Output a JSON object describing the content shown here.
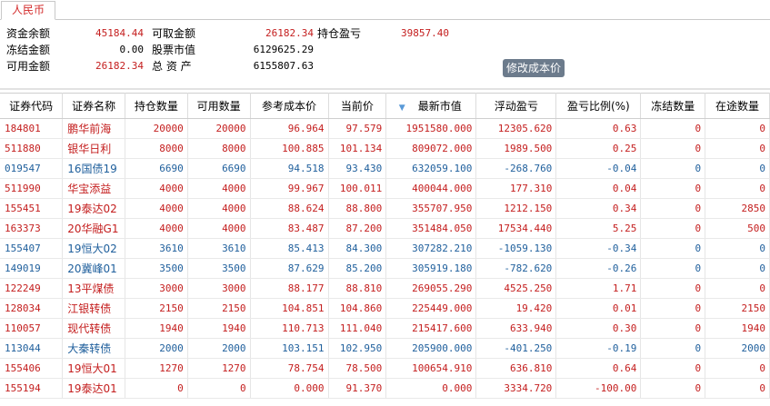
{
  "tab": {
    "label": "人民币"
  },
  "summary": {
    "row1": [
      {
        "label": "资金余额",
        "value": "45184.44"
      },
      {
        "label": "可取金额",
        "value": "26182.34"
      },
      {
        "label": "持仓盈亏",
        "value": "39857.40"
      }
    ],
    "row2": [
      {
        "label": "冻结金额",
        "value": "0.00"
      },
      {
        "label": "股票市值",
        "value": "6129625.29"
      }
    ],
    "row3": [
      {
        "label": "可用金额",
        "value": "26182.34"
      },
      {
        "label": "总 资 产",
        "value": "6155807.63"
      }
    ],
    "modify_cost_button": "修改成本价"
  },
  "table": {
    "headers": [
      "证券代码",
      "证券名称",
      "持仓数量",
      "可用数量",
      "参考成本价",
      "当前价",
      "最新市值",
      "浮动盈亏",
      "盈亏比例(%)",
      "冻结数量",
      "在途数量"
    ],
    "sorted_column": "最新市值",
    "rows": [
      {
        "color": "red",
        "cells": [
          "184801",
          "鹏华前海",
          "20000",
          "20000",
          "96.964",
          "97.579",
          "1951580.000",
          "12305.620",
          "0.63",
          "0",
          "0"
        ]
      },
      {
        "color": "red",
        "cells": [
          "511880",
          "银华日利",
          "8000",
          "8000",
          "100.885",
          "101.134",
          "809072.000",
          "1989.500",
          "0.25",
          "0",
          "0"
        ]
      },
      {
        "color": "blue",
        "cells": [
          "019547",
          "16国债19",
          "6690",
          "6690",
          "94.518",
          "93.430",
          "632059.100",
          "-268.760",
          "-0.04",
          "0",
          "0"
        ]
      },
      {
        "color": "red",
        "cells": [
          "511990",
          "华宝添益",
          "4000",
          "4000",
          "99.967",
          "100.011",
          "400044.000",
          "177.310",
          "0.04",
          "0",
          "0"
        ]
      },
      {
        "color": "red",
        "cells": [
          "155451",
          "19泰达02",
          "4000",
          "4000",
          "88.624",
          "88.800",
          "355707.950",
          "1212.150",
          "0.34",
          "0",
          "2850"
        ]
      },
      {
        "color": "red",
        "cells": [
          "163373",
          "20华融G1",
          "4000",
          "4000",
          "83.487",
          "87.200",
          "351484.050",
          "17534.440",
          "5.25",
          "0",
          "500"
        ]
      },
      {
        "color": "blue",
        "cells": [
          "155407",
          "19恒大02",
          "3610",
          "3610",
          "85.413",
          "84.300",
          "307282.210",
          "-1059.130",
          "-0.34",
          "0",
          "0"
        ]
      },
      {
        "color": "blue",
        "cells": [
          "149019",
          "20冀峰01",
          "3500",
          "3500",
          "87.629",
          "85.200",
          "305919.180",
          "-782.620",
          "-0.26",
          "0",
          "0"
        ]
      },
      {
        "color": "red",
        "cells": [
          "122249",
          "13平煤债",
          "3000",
          "3000",
          "88.177",
          "88.810",
          "269055.290",
          "4525.250",
          "1.71",
          "0",
          "0"
        ]
      },
      {
        "color": "red",
        "cells": [
          "128034",
          "江银转债",
          "2150",
          "2150",
          "104.851",
          "104.860",
          "225449.000",
          "19.420",
          "0.01",
          "0",
          "2150"
        ]
      },
      {
        "color": "red",
        "cells": [
          "110057",
          "现代转债",
          "1940",
          "1940",
          "110.713",
          "111.040",
          "215417.600",
          "633.940",
          "0.30",
          "0",
          "1940"
        ]
      },
      {
        "color": "blue",
        "cells": [
          "113044",
          "大秦转债",
          "2000",
          "2000",
          "103.151",
          "102.950",
          "205900.000",
          "-401.250",
          "-0.19",
          "0",
          "2000"
        ]
      },
      {
        "color": "red",
        "cells": [
          "155406",
          "19恒大01",
          "1270",
          "1270",
          "78.754",
          "78.500",
          "100654.910",
          "636.810",
          "0.64",
          "0",
          "0"
        ]
      },
      {
        "color": "red",
        "cells": [
          "155194",
          "19泰达01",
          "0",
          "0",
          "0.000",
          "91.370",
          "0.000",
          "3334.720",
          "-100.00",
          "0",
          "0"
        ]
      }
    ]
  },
  "colors": {
    "positive": "#c41e1e",
    "negative": "#1f5f9c",
    "button_bg": "#6c7b8c",
    "sort_indicator": "#5a9ad8"
  }
}
